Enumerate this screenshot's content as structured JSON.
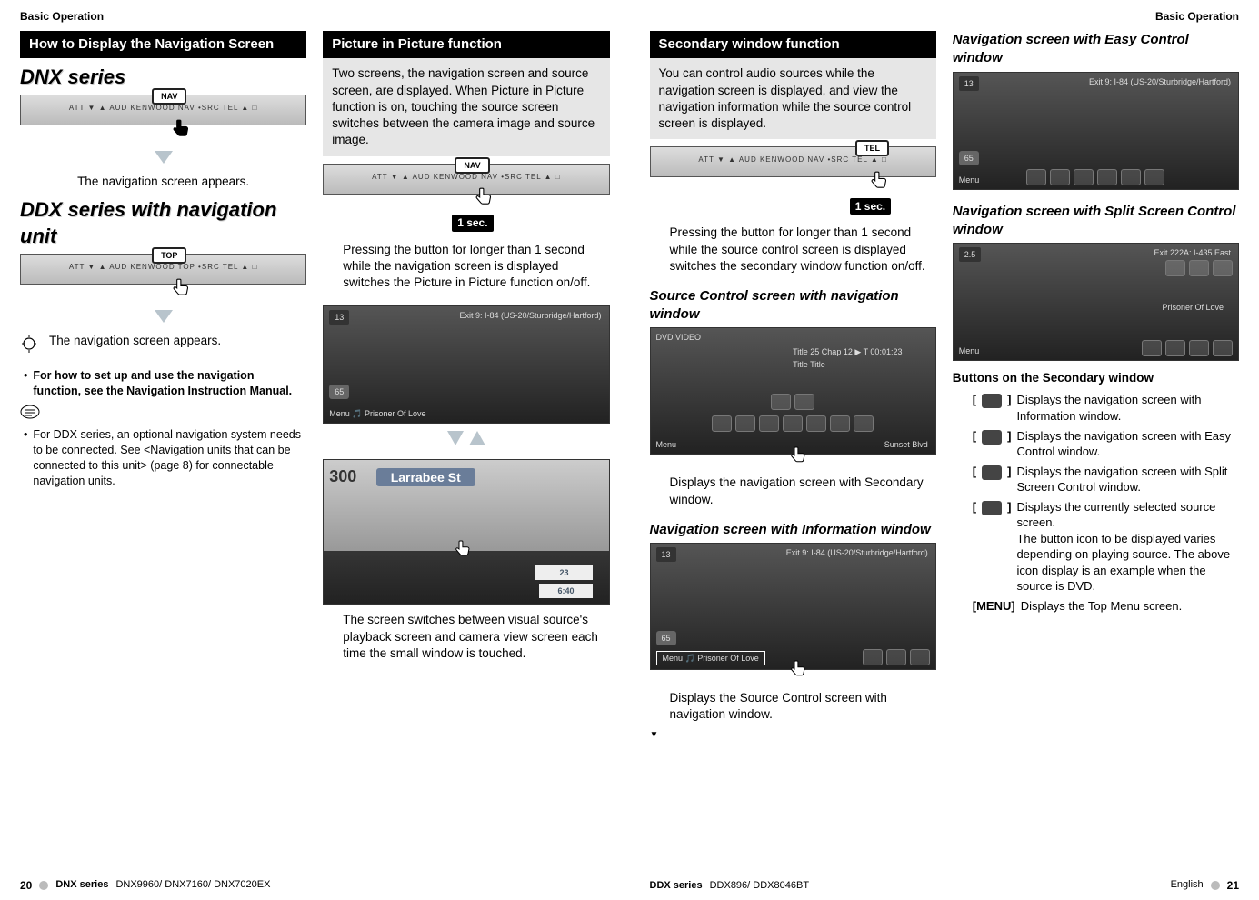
{
  "running_head": "Basic Operation",
  "left": {
    "header1": "How to Display the Navigation Screen",
    "series1": "DNX series",
    "nav_badge1": "NAV",
    "nav_line1": "ATT   ▼   ▲   AUD   KENWOOD   NAV   •SRC   TEL   ▲   □",
    "caption1": "The navigation screen appears.",
    "series2": "DDX series with navigation unit",
    "nav_badge2": "TOP",
    "nav_line2": "ATT   ▼   ▲   AUD   KENWOOD   TOP   •SRC   TEL   ▲   □",
    "caption2": "The navigation screen appears.",
    "bullet1": "For how to set up and use the navigation function, see the Navigation Instruction Manual.",
    "bullet2": "For DDX series, an optional navigation system needs to be connected. See <Navigation units that can be connected to this unit> (page 8) for connectable navigation units.",
    "header2": "Picture in Picture function",
    "grey1": "Two screens, the navigation screen and source screen, are displayed. When Picture in Picture function is on, touching the source screen switches between the camera image and source image.",
    "nav_badge3": "NAV",
    "nav_line3": "ATT   ▼   ▲   AUD   KENWOOD   NAV   •SRC   TEL   ▲   □",
    "onesec": "1 sec.",
    "para1": "Pressing the button for longer than 1 second while the navigation screen is displayed switches the Picture in Picture function on/off.",
    "ss1_tl": "13",
    "ss1_tr": "Exit 9: I-84 (US-20/Sturbridge/Hartford)",
    "ss1_bl": "65",
    "ss1_menu": "Menu  🎵 Prisoner Of Love",
    "ss2_tl": "300",
    "ss2_tr": "Larrabee St",
    "ss2_a": "23",
    "ss2_b": "6:40",
    "para2": "The screen switches between visual source's playback screen and camera view screen each time the small window is touched."
  },
  "right": {
    "header1": "Secondary window function",
    "grey1": "You can control audio sources while the navigation screen is displayed, and view the navigation information while the source control screen is displayed.",
    "nav_badge1": "TEL",
    "nav_line1": "ATT   ▼   ▲   AUD   KENWOOD   NAV   •SRC   TEL   ▲   □",
    "onesec": "1 sec.",
    "para1": "Pressing the button for longer than 1 second while the source control screen is displayed switches the secondary window function on/off.",
    "h3a": "Source Control screen with navigation window",
    "dvd_tl": "DVD VIDEO",
    "dvd_row": "Title 25    Chap 12   ▶   T 00:01:23",
    "dvd_row2": "Title    Title",
    "dvd_bl": "Menu",
    "dvd_br": "Sunset Blvd",
    "para2": "Displays the navigation screen with Secondary window.",
    "h3b": "Navigation screen with Information window",
    "ss_tl": "13",
    "ss_tr": "Exit 9: I-84 (US-20/Sturbridge/Hartford)",
    "ss_bl": "65",
    "ss_menu": "Menu  🎵 Prisoner Of Love",
    "para3": "Displays the Source Control screen with navigation window.",
    "h3c": "Navigation screen with Easy Control window",
    "ss2_tl": "13",
    "ss2_tr": "Exit 9: I-84 (US-20/Sturbridge/Hartford)",
    "ss2_bl": "65",
    "ss2_menu": "Menu",
    "h3d": "Navigation screen with Split Screen Control window",
    "ss3_tl": "2.5",
    "ss3_tr": "Exit 222A: I-435 East",
    "ss3_txt": "Prisoner Of Love",
    "ss3_menu": "Menu",
    "h4": "Buttons on the Secondary window",
    "btn1": "Displays the navigation screen with Information window.",
    "btn2": "Displays the navigation screen with Easy Control window.",
    "btn3": "Displays the navigation screen with Split Screen Control window.",
    "btn4a": "Displays the currently selected source screen.",
    "btn4b": "The button icon to be displayed varies depending on playing source. The above icon display is an example when the source is DVD.",
    "menu_label": "[MENU]",
    "btn5": "Displays the Top Menu screen."
  },
  "footer_left_pg": "20",
  "footer_left_series": "DNX series",
  "footer_left_models": "DNX9960/ DNX7160/ DNX7020EX",
  "footer_mid_series": "DDX series",
  "footer_mid_models": "DDX896/ DDX8046BT",
  "footer_right_lang": "English",
  "footer_right_pg": "21"
}
